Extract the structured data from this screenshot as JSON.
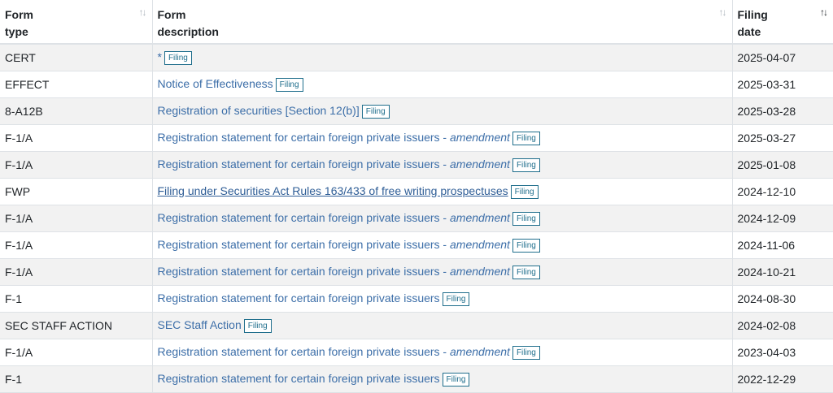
{
  "header": {
    "form_type": [
      "Form",
      "type"
    ],
    "form_description": [
      "Form",
      "description"
    ],
    "filing_date": [
      "Filing",
      "date"
    ],
    "sort_icon": "sort-both-icon",
    "sort_active_icon": "sort-desc-icon"
  },
  "badge_label": "Filing",
  "rows": [
    {
      "type": "CERT",
      "desc": "*",
      "amend": "",
      "date": "2025-04-07"
    },
    {
      "type": "EFFECT",
      "desc": "Notice of Effectiveness",
      "amend": "",
      "date": "2025-03-31"
    },
    {
      "type": "8-A12B",
      "desc": "Registration of securities [Section 12(b)]",
      "amend": "",
      "date": "2025-03-28"
    },
    {
      "type": "F-1/A",
      "desc": "Registration statement for certain foreign private issuers - ",
      "amend": "amendment",
      "date": "2025-03-27"
    },
    {
      "type": "F-1/A",
      "desc": "Registration statement for certain foreign private issuers - ",
      "amend": "amendment",
      "date": "2025-01-08"
    },
    {
      "type": "FWP",
      "desc": "Filing under Securities Act Rules 163/433 of free writing prospectuses",
      "amend": "",
      "date": "2024-12-10",
      "underline": true
    },
    {
      "type": "F-1/A",
      "desc": "Registration statement for certain foreign private issuers - ",
      "amend": "amendment",
      "date": "2024-12-09"
    },
    {
      "type": "F-1/A",
      "desc": "Registration statement for certain foreign private issuers - ",
      "amend": "amendment",
      "date": "2024-11-06"
    },
    {
      "type": "F-1/A",
      "desc": "Registration statement for certain foreign private issuers - ",
      "amend": "amendment",
      "date": "2024-10-21"
    },
    {
      "type": "F-1",
      "desc": "Registration statement for certain foreign private issuers",
      "amend": "",
      "date": "2024-08-30"
    },
    {
      "type": "SEC STAFF ACTION",
      "desc": "SEC Staff Action",
      "amend": "",
      "date": "2024-02-08"
    },
    {
      "type": "F-1/A",
      "desc": "Registration statement for certain foreign private issuers - ",
      "amend": "amendment",
      "date": "2023-04-03"
    },
    {
      "type": "F-1",
      "desc": "Registration statement for certain foreign private issuers",
      "amend": "",
      "date": "2022-12-29"
    }
  ]
}
